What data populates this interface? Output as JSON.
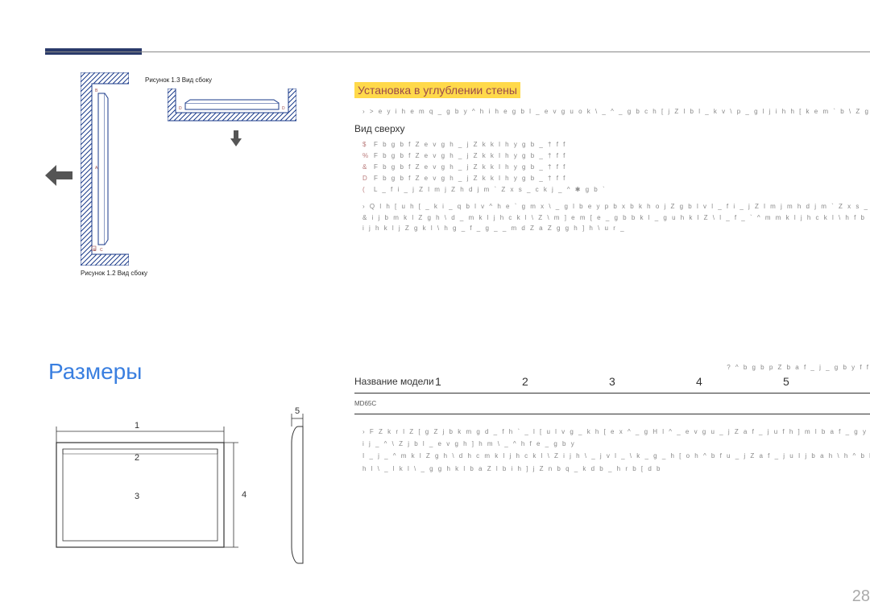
{
  "captions": {
    "fig12": "Рисунок 1.2 Вид сбоку",
    "fig13": "Рисунок 1.3 Вид сбоку"
  },
  "labels": {
    "A": "A",
    "B": "B",
    "C": "C",
    "D": "D",
    "E": "E"
  },
  "install": {
    "title": "Установка в углублении стены",
    "intro": "› > e y   i h e m q _ g b y   ^ h i h e g b l _ e v g u o   k \\ _ ^ _ g b c   h [ j Z l b l _ k v   \\   p _ g l j   i h   h [ k e m ` b \\ Z g b x   d",
    "topview": "Вид сверху",
    "rows": [
      {
        "label": "$",
        "text": "F b g b f Z e v g h _   j Z k k l h y g b _   †      f f"
      },
      {
        "label": "%",
        "text": "F b g b f Z e v g h _   j Z k k l h y g b _   †      f f"
      },
      {
        "label": "&",
        "text": "F b g b f Z e v g h _   j Z k k l h y g b _   †      f f"
      },
      {
        "label": "D",
        "text": "F b g b f Z e v g h _   j Z k k l h y g b _   †      f f"
      },
      {
        "label": "(",
        "text": "L _ f i _ j Z l m j Z   h d j m ` Z x s _ c   k j _ ^ ✱   g b `"
      }
    ],
    "note": "›  Q l h [ u   h [ _ k i _ q b l v   ^ h e ` g m x   \\ _ g l b e y p b x   b   k h o j Z g b l v   l _ f i _ j Z l m j m   h d j m ` Z x s _ h   i j h\n&   i j b   m k l Z g h \\ d _   m k l j h c k l \\ Z   \\   m ] e m [ e _ g b b   k l _ g u   h k l Z \\ l _   f _ ` ^ m   m k l j h c k l \\ h f   b\n  i j h k l j Z g k l \\ h   g _   f _ g _ _   m d Z a Z g g h ] h   \\ u r _"
  },
  "dimensions": {
    "title": "Размеры",
    "unit": "? ^ b g b p Z   b a f _ j _ g b y   f f",
    "headers": {
      "model": "Название модели",
      "cols": [
        "1",
        "2",
        "3",
        "4",
        "5"
      ]
    },
    "rows": [
      {
        "model": "MD65C",
        "cells": [
          "",
          "",
          "",
          "",
          ""
        ]
      }
    ],
    "notes": "›  F Z k r l Z [   g Z   j b k m g d _   f h ` _ l   [ u l v   g _   k h [ e x ^ _ g   H l ^ _ e v g u _   j Z a f _ j u   f h ] m l   b a f _ g y l v\ni j _ ^ \\ Z j b l _ e v g h ] h   m \\ _ ^ h f e _ g b y\nI _ j _ ^   m k l Z g h \\ d h c   m k l j h c k l \\ Z   i j h \\ _ j v l _   \\ k _   g _ h [ o h ^ b f u _   j Z a f _ j u   I j b a h \\ h ^ b l _ e v\nh l \\ _ l k l \\ _ g g h k l b   a Z   l b i h ] j Z n b q _ k d b _   h r b [ d b"
  },
  "dim_fig": {
    "front": [
      "1",
      "2",
      "3",
      "4"
    ],
    "side": "5"
  },
  "page_number": "28",
  "colors": {
    "accent_blue": "#3a7fe0",
    "highlight_yellow": "#ffd94a",
    "dark_bar": "#2a3a6a"
  }
}
